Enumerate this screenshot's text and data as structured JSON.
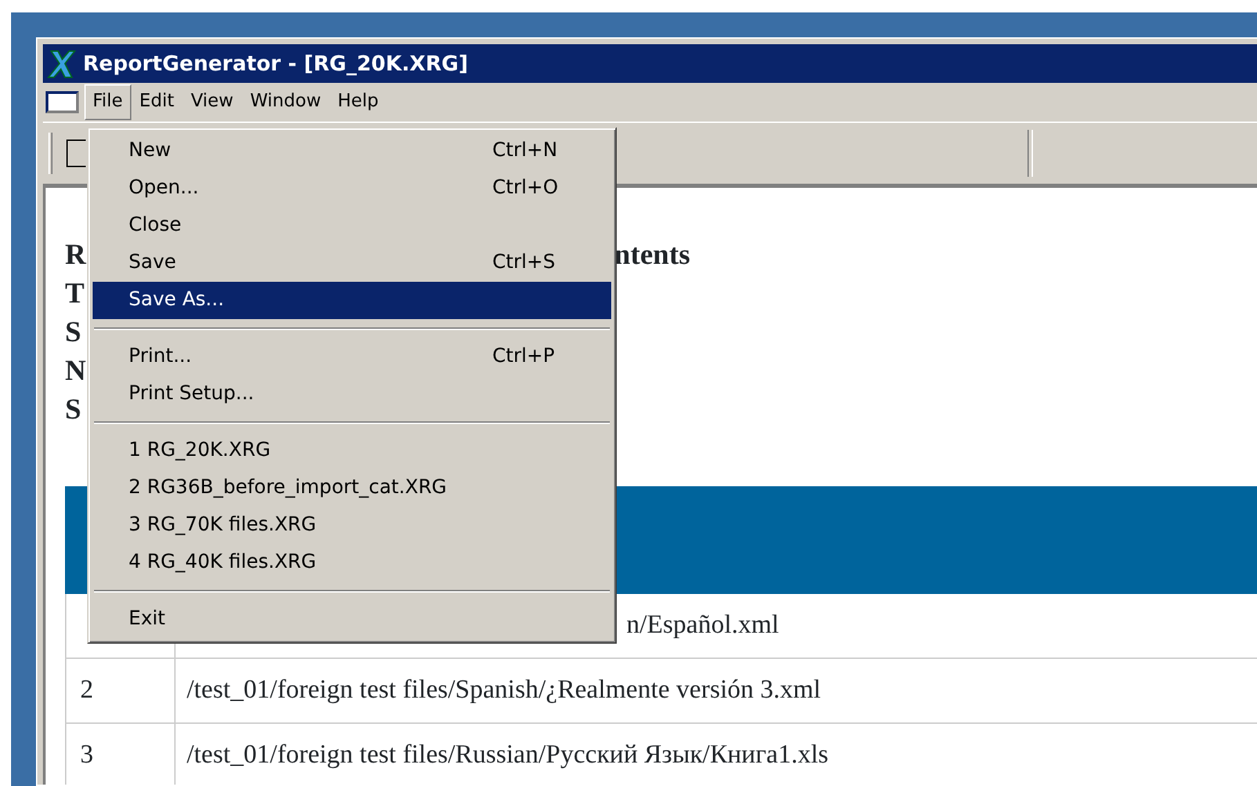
{
  "window": {
    "title": "ReportGenerator - [RG_20K.XRG]"
  },
  "menubar": [
    {
      "label": "File",
      "selected": true
    },
    {
      "label": "Edit",
      "selected": false
    },
    {
      "label": "View",
      "selected": false
    },
    {
      "label": "Window",
      "selected": false
    },
    {
      "label": "Help",
      "selected": false
    }
  ],
  "file_menu": [
    {
      "kind": "item",
      "label": "New",
      "shortcut": "Ctrl+N",
      "selected": false
    },
    {
      "kind": "item",
      "label": "Open...",
      "shortcut": "Ctrl+O",
      "selected": false
    },
    {
      "kind": "item",
      "label": "Close",
      "selected": false
    },
    {
      "kind": "item",
      "label": "Save",
      "shortcut": "Ctrl+S",
      "selected": false
    },
    {
      "kind": "item",
      "label": "Save As...",
      "selected": true
    },
    {
      "kind": "separator"
    },
    {
      "kind": "item",
      "label": "Print...",
      "shortcut": "Ctrl+P",
      "selected": false
    },
    {
      "kind": "item",
      "label": "Print Setup...",
      "selected": false
    },
    {
      "kind": "separator"
    },
    {
      "kind": "item",
      "label": "1 RG_20K.XRG",
      "selected": false
    },
    {
      "kind": "item",
      "label": "2 RG36B_before_import_cat.XRG",
      "selected": false
    },
    {
      "kind": "item",
      "label": "3 RG_70K files.XRG",
      "selected": false
    },
    {
      "kind": "item",
      "label": "4 RG_40K files.XRG",
      "selected": false
    },
    {
      "kind": "separator"
    },
    {
      "kind": "item",
      "label": "Exit",
      "selected": false
    }
  ],
  "document": {
    "heading_lines": [
      {
        "start": "R",
        "end": "ntents"
      },
      {
        "start": "T"
      },
      {
        "start": "S"
      },
      {
        "start": "N"
      },
      {
        "start": "S"
      }
    ],
    "table": {
      "rows": [
        {
          "number": "",
          "path": "n/Español.xml"
        },
        {
          "number": "2",
          "path": "/test_01/foreign test files/Spanish/¿Realmente versión 3.xml"
        },
        {
          "number": "3",
          "path": "/test_01/foreign test files/Russian/Русский Язык/Книга1.xls"
        }
      ]
    }
  }
}
